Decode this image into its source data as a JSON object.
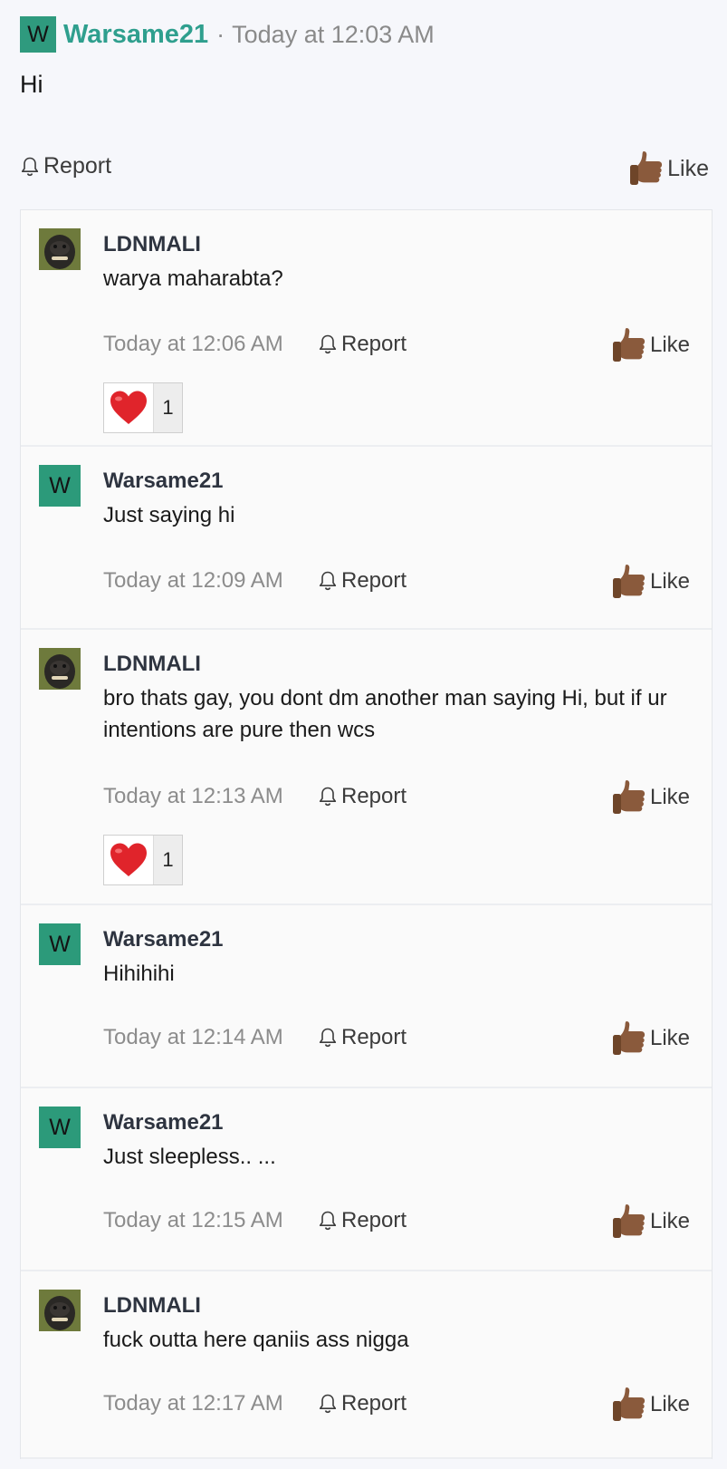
{
  "post": {
    "avatar_letter": "W",
    "author": "Warsame21",
    "separator": "·",
    "time": "Today at 12:03 AM",
    "body": "Hi",
    "report_label": "Report",
    "like_label": "Like"
  },
  "comments": [
    {
      "avatar": "photo",
      "author": "LDNMALI",
      "text": "warya maharabta?",
      "time": "Today at 12:06 AM",
      "report_label": "Report",
      "like_label": "Like",
      "reaction": {
        "icon": "heart-icon",
        "count": "1"
      }
    },
    {
      "avatar": "letter",
      "avatar_letter": "W",
      "author": "Warsame21",
      "text": "Just saying hi",
      "time": "Today at 12:09 AM",
      "report_label": "Report",
      "like_label": "Like"
    },
    {
      "avatar": "photo",
      "author": "LDNMALI",
      "text": "bro thats gay, you dont dm another man saying Hi, but if ur intentions are pure then wcs",
      "time": "Today at 12:13 AM",
      "report_label": "Report",
      "like_label": "Like",
      "reaction": {
        "icon": "heart-icon",
        "count": "1"
      }
    },
    {
      "avatar": "letter",
      "avatar_letter": "W",
      "author": "Warsame21",
      "text": "Hihihihi",
      "time": "Today at 12:14 AM",
      "report_label": "Report",
      "like_label": "Like"
    },
    {
      "avatar": "letter",
      "avatar_letter": "W",
      "author": "Warsame21",
      "text": "Just sleepless.. ...",
      "time": "Today at 12:15 AM",
      "report_label": "Report",
      "like_label": "Like"
    },
    {
      "avatar": "photo",
      "author": "LDNMALI",
      "text": "fuck outta here qaniis ass nigga",
      "time": "Today at 12:17 AM",
      "report_label": "Report",
      "like_label": "Like"
    }
  ],
  "colors": {
    "accent": "#2f9f8e",
    "avatar_bg": "#2c9a7a",
    "heart": "#e0242b",
    "thumb": "#8a5a3c"
  }
}
